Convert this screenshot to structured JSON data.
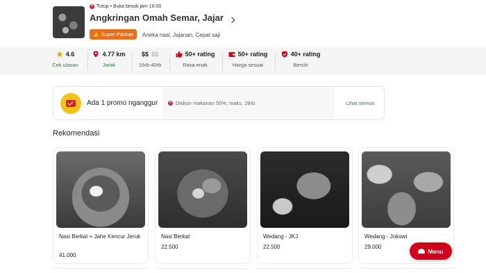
{
  "header": {
    "status_text": "Tutup • Buka besok jam 16:00",
    "name": "Angkringan Omah Semar, Jajar",
    "badge": "Super Partner",
    "cuisines": "Aneka nasi, Jajanan, Cepat saji"
  },
  "info": [
    {
      "value": "4.6",
      "sub": "Cek ulasan",
      "icon": "star-icon"
    },
    {
      "value": "4.77 km",
      "sub": "Jarak",
      "icon": "location-pin-icon"
    },
    {
      "value": "$$$$",
      "sub": "16rb-40rb",
      "icon": "price-icon"
    },
    {
      "value": "50+ rating",
      "sub": "Rasa enak",
      "icon": "thumbs-up-icon"
    },
    {
      "value": "50+ rating",
      "sub": "Harga sesuai",
      "icon": "wallet-icon"
    },
    {
      "value": "40+ rating",
      "sub": "Bersih",
      "icon": "shield-icon"
    }
  ],
  "price_level": {
    "filled": "$$",
    "empty": "$$"
  },
  "promo": {
    "title": "Ada 1 promo nganggur",
    "detail": "Diskon makanan 50%, maks. 28rb",
    "see_all": "Lihat semua"
  },
  "recommendations": {
    "title": "Rekomendasi",
    "items": [
      {
        "name": "Nasi Berkat + Jahe Kencur Jeruk",
        "price": "41.000"
      },
      {
        "name": "Nasi Berkat",
        "price": "22.500"
      },
      {
        "name": "Wedang - JKJ",
        "price": "22.500"
      },
      {
        "name": "Wedang - Jokowi",
        "price": "29.000"
      }
    ]
  },
  "menu_button": "Menu",
  "colors": {
    "accent_green": "#1b8a3a",
    "accent_red": "#d0021b",
    "badge_orange": "#e3711f",
    "promo_yellow": "#f3c418"
  }
}
